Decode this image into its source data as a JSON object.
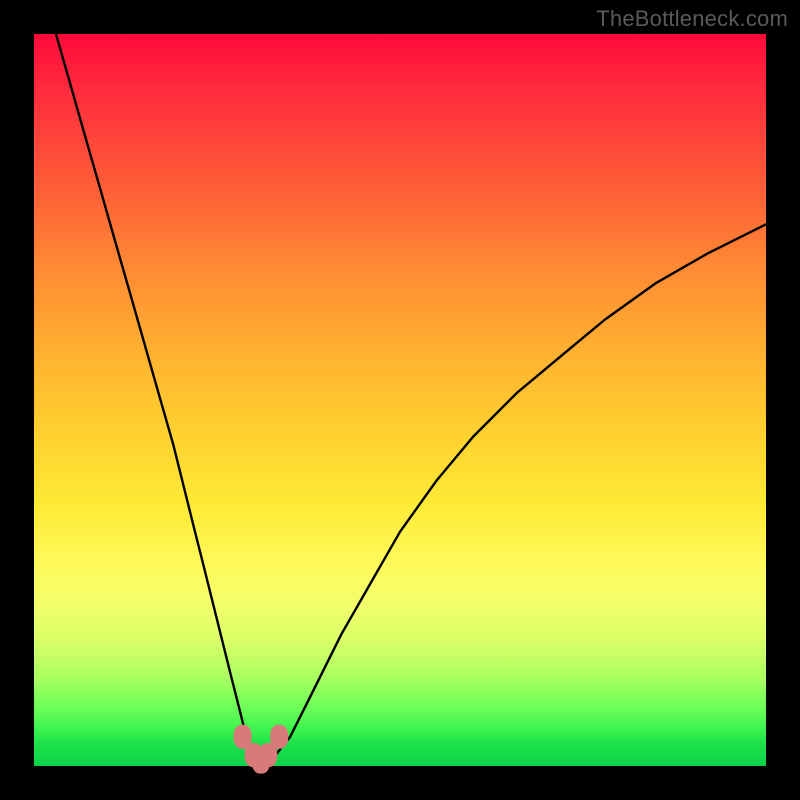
{
  "watermark": {
    "text": "TheBottleneck.com"
  },
  "colors": {
    "page_bg": "#000000",
    "curve_stroke": "#000000",
    "marker_fill": "#d97a7a",
    "marker_stroke": "#c66"
  },
  "chart_data": {
    "type": "line",
    "title": "",
    "xlabel": "",
    "ylabel": "",
    "xlim": [
      0,
      100
    ],
    "ylim": [
      0,
      100
    ],
    "grid": false,
    "legend": false,
    "series": [
      {
        "name": "bottleneck-curve",
        "x": [
          3,
          5,
          7,
          9,
          11,
          13,
          15,
          17,
          19,
          20,
          21,
          22,
          23,
          24,
          25,
          26,
          27,
          28,
          29,
          30,
          31,
          32,
          33,
          35,
          38,
          42,
          46,
          50,
          55,
          60,
          66,
          72,
          78,
          85,
          92,
          100
        ],
        "y": [
          100,
          93,
          86,
          79,
          72,
          65,
          58,
          51,
          44,
          40,
          36,
          32,
          28,
          24,
          20,
          16,
          12,
          8,
          4,
          1.5,
          0.5,
          0.5,
          1.5,
          4,
          10,
          18,
          25,
          32,
          39,
          45,
          51,
          56,
          61,
          66,
          70,
          74
        ]
      }
    ],
    "markers": [
      {
        "name": "marker-left",
        "x": 28.5,
        "y": 4
      },
      {
        "name": "marker-mid-lo",
        "x": 30.0,
        "y": 1.5
      },
      {
        "name": "marker-bottom",
        "x": 31.0,
        "y": 0.6
      },
      {
        "name": "marker-mid-hi",
        "x": 32.0,
        "y": 1.5
      },
      {
        "name": "marker-right",
        "x": 33.5,
        "y": 4
      }
    ],
    "gradient_stops": [
      {
        "pos": 0,
        "hex": "#ff0a3a"
      },
      {
        "pos": 20,
        "hex": "#ff5a38"
      },
      {
        "pos": 44,
        "hex": "#ffb330"
      },
      {
        "pos": 72,
        "hex": "#fff95a"
      },
      {
        "pos": 88,
        "hex": "#a8ff60"
      },
      {
        "pos": 100,
        "hex": "#0cd248"
      }
    ]
  }
}
